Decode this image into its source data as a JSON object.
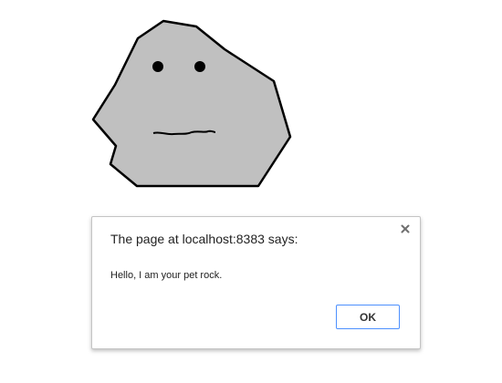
{
  "colors": {
    "rock_fill": "#c0c0c0",
    "rock_outline": "#000000",
    "ok_border": "#4d90fe"
  },
  "dialog": {
    "title": "The page at localhost:8383 says:",
    "message": "Hello, I am your pet rock.",
    "close_icon": "close-icon",
    "ok_label": "OK"
  }
}
